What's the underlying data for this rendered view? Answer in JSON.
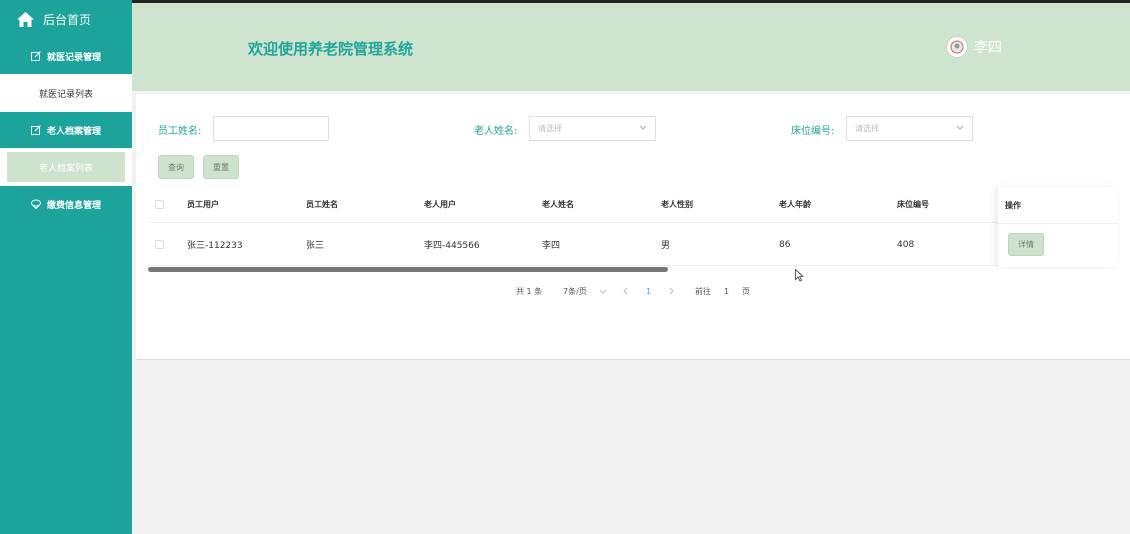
{
  "sidebar": {
    "home_label": "后台首页",
    "groups": [
      {
        "label": "就医记录管理",
        "sub": "就医记录列表",
        "active": false
      },
      {
        "label": "老人档案管理",
        "sub": "老人档案列表",
        "active": true
      },
      {
        "label": "缴费信息管理"
      }
    ]
  },
  "header": {
    "title": "欢迎使用养老院管理系统",
    "user_name": "李四"
  },
  "filters": {
    "employee_name_label": "员工姓名:",
    "employee_name_value": "",
    "elder_name_label": "老人姓名:",
    "elder_name_placeholder": "请选择",
    "bed_no_label": "床位编号:",
    "bed_no_placeholder": "请选择",
    "query_button": "查询",
    "reset_button": "重置"
  },
  "table": {
    "columns": [
      "员工用户",
      "员工姓名",
      "老人用户",
      "老人姓名",
      "老人性别",
      "老人年龄",
      "床位编号",
      "操作"
    ],
    "rows": [
      {
        "employee_user": "张三-112233",
        "employee_name": "张三",
        "elder_user": "李四-445566",
        "elder_name": "李四",
        "elder_gender": "男",
        "elder_age": "86",
        "bed_no": "408",
        "action": "详情"
      }
    ]
  },
  "pagination": {
    "total": "共 1 条",
    "page_size": "7条/页",
    "current_page": "1",
    "goto_label": "前往",
    "goto_value": "1",
    "page_suffix": "页"
  },
  "colors": {
    "sidebar_bg": "#1ba39c",
    "header_bg": "#cfe4cf",
    "accent_text": "#21a59a",
    "button_bg": "#cde3cd"
  }
}
